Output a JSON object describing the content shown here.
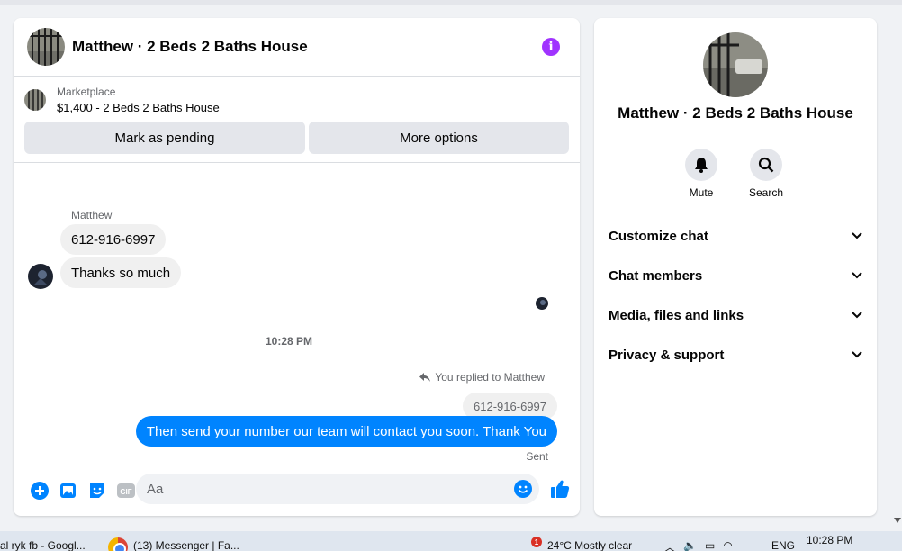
{
  "chat": {
    "title": "Matthew · 2 Beds 2 Baths House",
    "info_icon": "i",
    "marketplace": {
      "label": "Marketplace",
      "item": "$1,400 - 2 Beds 2 Baths House"
    },
    "actions": {
      "mark_pending": "Mark as pending",
      "more_options": "More options"
    },
    "messages": {
      "sender_name": "Matthew",
      "incoming": [
        "612-916-6997",
        "Thanks so much"
      ],
      "timestamp": "10:28 PM",
      "replied_label": "You replied to Matthew",
      "quoted": "612-916-6997",
      "outgoing": "Then send your number our team will contact you soon. Thank You",
      "status": "Sent"
    },
    "composer": {
      "placeholder": "Aa",
      "gif_label": "GIF"
    }
  },
  "info": {
    "title": "Matthew · 2 Beds 2 Baths House",
    "quick_actions": {
      "mute": "Mute",
      "search": "Search"
    },
    "sections": [
      "Customize chat",
      "Chat members",
      "Media, files and links",
      "Privacy & support"
    ]
  },
  "taskbar": {
    "item1": "al ryk fb - Googl...",
    "item2": "(13) Messenger | Fa...",
    "weather_badge": "1",
    "weather": "24°C  Mostly clear",
    "language": "ENG",
    "clock": "10:28 PM"
  },
  "colors": {
    "accent": "#0084ff",
    "info": "#a033ff",
    "bubble_in": "#f0f0f0",
    "background": "#f0f2f5"
  },
  "icons": [
    "info-icon",
    "reply-icon",
    "plus-icon",
    "image-icon",
    "sticker-icon",
    "gif-icon",
    "emoji-icon",
    "like-icon",
    "bell-icon",
    "search-icon",
    "chevron-down-icon",
    "chrome-icon"
  ]
}
